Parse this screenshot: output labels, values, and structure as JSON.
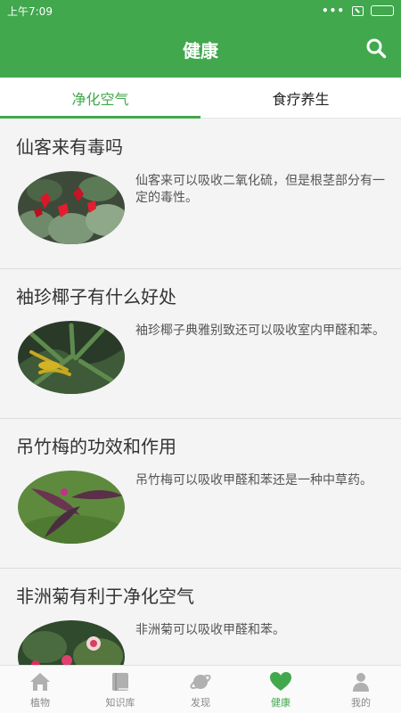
{
  "status": {
    "time": "上午7:09",
    "dots": "•••"
  },
  "header": {
    "title": "健康"
  },
  "tabs": [
    {
      "label": "净化空气",
      "active": true
    },
    {
      "label": "食疗养生",
      "active": false
    }
  ],
  "articles": [
    {
      "title": "仙客来有毒吗",
      "desc": "仙客来可以吸收二氧化硫，但是根茎部分有一定的毒性。"
    },
    {
      "title": "袖珍椰子有什么好处",
      "desc": "袖珍椰子典雅别致还可以吸收室内甲醛和苯。"
    },
    {
      "title": "吊竹梅的功效和作用",
      "desc": "吊竹梅可以吸收甲醛和苯还是一种中草药。"
    },
    {
      "title": "非洲菊有利于净化空气",
      "desc": "非洲菊可以吸收甲醛和苯。"
    }
  ],
  "nav": [
    {
      "label": "植物",
      "icon": "house-icon"
    },
    {
      "label": "知识库",
      "icon": "book-icon"
    },
    {
      "label": "发现",
      "icon": "planet-icon"
    },
    {
      "label": "健康",
      "icon": "heart-icon",
      "active": true
    },
    {
      "label": "我的",
      "icon": "person-icon"
    }
  ],
  "colors": {
    "primary": "#41a84d"
  }
}
